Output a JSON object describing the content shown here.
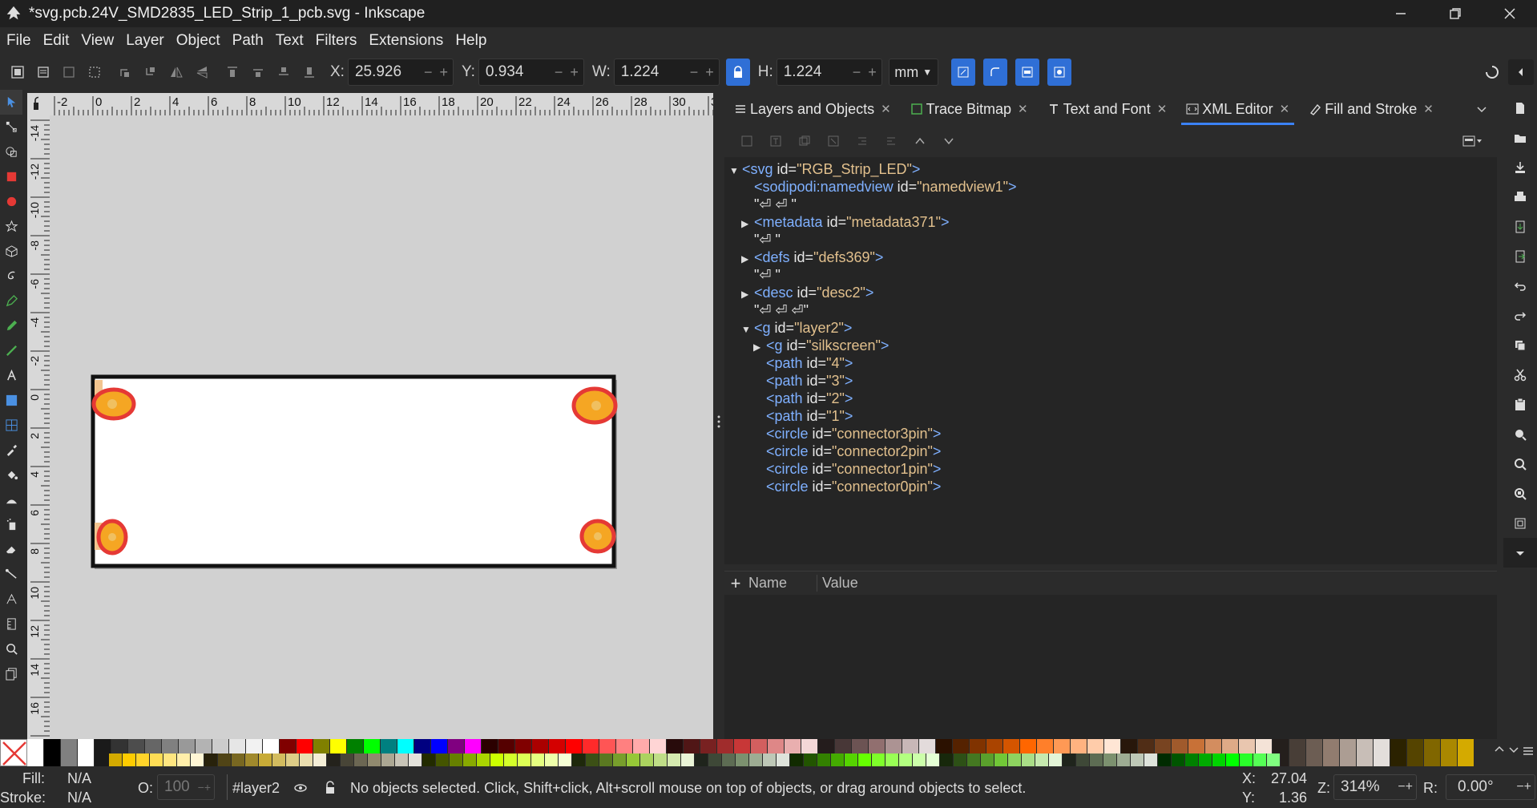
{
  "window": {
    "title": "*svg.pcb.24V_SMD2835_LED_Strip_1_pcb.svg - Inkscape"
  },
  "menu": [
    "File",
    "Edit",
    "View",
    "Layer",
    "Object",
    "Path",
    "Text",
    "Filters",
    "Extensions",
    "Help"
  ],
  "toolbar": {
    "x_label": "X:",
    "x_value": "25.926",
    "y_label": "Y:",
    "y_value": "0.934",
    "w_label": "W:",
    "w_value": "1.224",
    "h_label": "H:",
    "h_value": "1.224",
    "unit": "mm"
  },
  "ruler": {
    "h_labels": [
      "-2",
      "0",
      "2",
      "4",
      "6",
      "8",
      "10",
      "12",
      "14",
      "16",
      "18",
      "20",
      "22",
      "24",
      "26",
      "28",
      "30",
      "32"
    ],
    "v_labels": [
      "-14",
      "-12",
      "-10",
      "-8",
      "-6",
      "-4",
      "-2",
      "0",
      "2",
      "4",
      "6",
      "8",
      "10",
      "12",
      "14",
      "16",
      "18"
    ]
  },
  "panel": {
    "tabs": [
      {
        "label": "Layers and Objects",
        "icon": "layers-icon",
        "active": false
      },
      {
        "label": "Trace Bitmap",
        "icon": "trace-bitmap-icon",
        "active": false
      },
      {
        "label": "Text and Font",
        "icon": "text-icon",
        "active": false
      },
      {
        "label": "XML Editor",
        "icon": "xml-editor-icon",
        "active": true
      },
      {
        "label": "Fill and Stroke",
        "icon": "fill-stroke-icon",
        "active": false
      }
    ],
    "xml_nodes": [
      {
        "indent": 0,
        "expander": "down",
        "tag": "<svg",
        "attr": "id=",
        "val": "\"RGB_Strip_LED\"",
        "end": ">"
      },
      {
        "indent": 1,
        "expander": "",
        "tag": "<sodipodi:namedview",
        "attr": "id=",
        "val": "\"namedview1\"",
        "end": ">"
      },
      {
        "indent": 1,
        "expander": "",
        "text": "\"⏎ ⏎ \""
      },
      {
        "indent": 1,
        "expander": "right",
        "tag": "<metadata",
        "attr": "id=",
        "val": "\"metadata371\"",
        "end": ">"
      },
      {
        "indent": 1,
        "expander": "",
        "text": "\"⏎ \""
      },
      {
        "indent": 1,
        "expander": "right",
        "tag": "<defs",
        "attr": "id=",
        "val": "\"defs369\"",
        "end": ">"
      },
      {
        "indent": 1,
        "expander": "",
        "text": "\"⏎ \""
      },
      {
        "indent": 1,
        "expander": "right",
        "tag": "<desc",
        "attr": "id=",
        "val": "\"desc2\"",
        "end": ">"
      },
      {
        "indent": 1,
        "expander": "",
        "text": "\"⏎ ⏎ ⏎\""
      },
      {
        "indent": 1,
        "expander": "down",
        "tag": "<g",
        "attr": "id=",
        "val": "\"layer2\"",
        "end": ">"
      },
      {
        "indent": 2,
        "expander": "right",
        "tag": "<g",
        "attr": "id=",
        "val": "\"silkscreen\"",
        "end": ">"
      },
      {
        "indent": 2,
        "expander": "",
        "tag": "<path",
        "attr": "id=",
        "val": "\"4\"",
        "end": ">"
      },
      {
        "indent": 2,
        "expander": "",
        "tag": "<path",
        "attr": "id=",
        "val": "\"3\"",
        "end": ">"
      },
      {
        "indent": 2,
        "expander": "",
        "tag": "<path",
        "attr": "id=",
        "val": "\"2\"",
        "end": ">"
      },
      {
        "indent": 2,
        "expander": "",
        "tag": "<path",
        "attr": "id=",
        "val": "\"1\"",
        "end": ">"
      },
      {
        "indent": 2,
        "expander": "",
        "tag": "<circle",
        "attr": "id=",
        "val": "\"connector3pin\"",
        "end": ">"
      },
      {
        "indent": 2,
        "expander": "",
        "tag": "<circle",
        "attr": "id=",
        "val": "\"connector2pin\"",
        "end": ">"
      },
      {
        "indent": 2,
        "expander": "",
        "tag": "<circle",
        "attr": "id=",
        "val": "\"connector1pin\"",
        "end": ">"
      },
      {
        "indent": 2,
        "expander": "",
        "tag": "<circle",
        "attr": "id=",
        "val": "\"connector0pin\"",
        "end": ">"
      }
    ],
    "attr_header": {
      "add": "+",
      "name": "Name",
      "value": "Value"
    }
  },
  "palette_row1": [
    "#ffffff",
    "#000000",
    "#808080",
    "#ffffff",
    "#1a1a1a",
    "#333333",
    "#4d4d4d",
    "#666666",
    "#808080",
    "#999999",
    "#b3b3b3",
    "#cccccc",
    "#e6e6e6",
    "#f2f2f2",
    "#ffffff",
    "#800000",
    "#ff0000",
    "#808000",
    "#ffff00",
    "#008000",
    "#00ff00",
    "#008080",
    "#00ffff",
    "#000080",
    "#0000ff",
    "#800080",
    "#ff00ff",
    "#2b0000",
    "#550000",
    "#800000",
    "#aa0000",
    "#d40000",
    "#ff0000",
    "#ff2a2a",
    "#ff5555",
    "#ff8080",
    "#ffaaaa",
    "#ffd5d5",
    "#280b0b",
    "#501616",
    "#782121",
    "#a02c2c",
    "#c83737",
    "#d35f5f",
    "#de8787",
    "#e9afaf",
    "#f4d7d7",
    "#241c1c",
    "#483737",
    "#6c5353",
    "#916f6f",
    "#ac9393",
    "#c8b7b7",
    "#e3dbdb",
    "#2b1100",
    "#552200",
    "#803300",
    "#aa4400",
    "#d45500",
    "#ff6600",
    "#ff7f2a",
    "#ff9955",
    "#ffb380",
    "#ffccaa",
    "#ffe6d5",
    "#28170b",
    "#502d16",
    "#784421",
    "#a05a2c",
    "#c87137",
    "#d38d5f",
    "#deaa87",
    "#e9c6af",
    "#f4e3d7",
    "#241f1c",
    "#483e37",
    "#6c5d53",
    "#917c6f",
    "#ac9d93",
    "#c8beb7",
    "#e3dedb",
    "#2b2200",
    "#554400",
    "#806600",
    "#aa8800",
    "#d4aa00"
  ],
  "palette_row2": [
    "#d4aa00",
    "#ffcc00",
    "#ffd42a",
    "#ffdd55",
    "#ffe680",
    "#ffeeaa",
    "#fff6d5",
    "#28220b",
    "#504416",
    "#786721",
    "#a0892c",
    "#c8ab37",
    "#d3bc5f",
    "#decd87",
    "#e9ddaf",
    "#f4eed7",
    "#24221c",
    "#484537",
    "#6c6753",
    "#918a6f",
    "#aca793",
    "#c8c4b7",
    "#e3e2db",
    "#222b00",
    "#445500",
    "#668000",
    "#88aa00",
    "#aad400",
    "#ccff00",
    "#d4ff2a",
    "#ddff55",
    "#e5ff80",
    "#eeffaa",
    "#f6ffd5",
    "#1e280b",
    "#3c5016",
    "#5a7821",
    "#789f2c",
    "#96c837",
    "#abd35f",
    "#c0de87",
    "#d5e9af",
    "#eaf4d7",
    "#1f241c",
    "#3e4837",
    "#5d6c53",
    "#7c916f",
    "#9dac93",
    "#bec8b7",
    "#dee3db",
    "#112b00",
    "#225500",
    "#338000",
    "#44aa00",
    "#55d400",
    "#66ff00",
    "#7fff2a",
    "#99ff55",
    "#b3ff80",
    "#ccffaa",
    "#e5ffd5",
    "#17280b",
    "#2d5016",
    "#447821",
    "#5aa02c",
    "#71c837",
    "#8dd35f",
    "#aade87",
    "#c6e9af",
    "#e3f4d7",
    "#1f241c",
    "#3e4837",
    "#5d6c53",
    "#7c916f",
    "#9dac93",
    "#bec8b7",
    "#dee3db",
    "#002b00",
    "#005500",
    "#008000",
    "#00aa00",
    "#00d400",
    "#00ff00",
    "#2aff2a",
    "#55ff55",
    "#80ff80"
  ],
  "status": {
    "fill_label": "Fill:",
    "fill_value": "N/A",
    "stroke_label": "Stroke:",
    "stroke_value": "N/A",
    "opacity_label": "O:",
    "opacity_value": "100",
    "layer": "#layer2",
    "message": "No objects selected. Click, Shift+click, Alt+scroll mouse on top of objects, or drag around objects to select.",
    "x_label": "X:",
    "x_value": "27.04",
    "y_label": "Y:",
    "y_value": "1.36",
    "zoom_label": "Z:",
    "zoom_value": "314%",
    "rot_label": "R:",
    "rot_value": "0.00°"
  },
  "colors": {
    "accent": "#2f6fd6",
    "pad_orange": "#f5a623",
    "pad_ring": "#e53935"
  }
}
